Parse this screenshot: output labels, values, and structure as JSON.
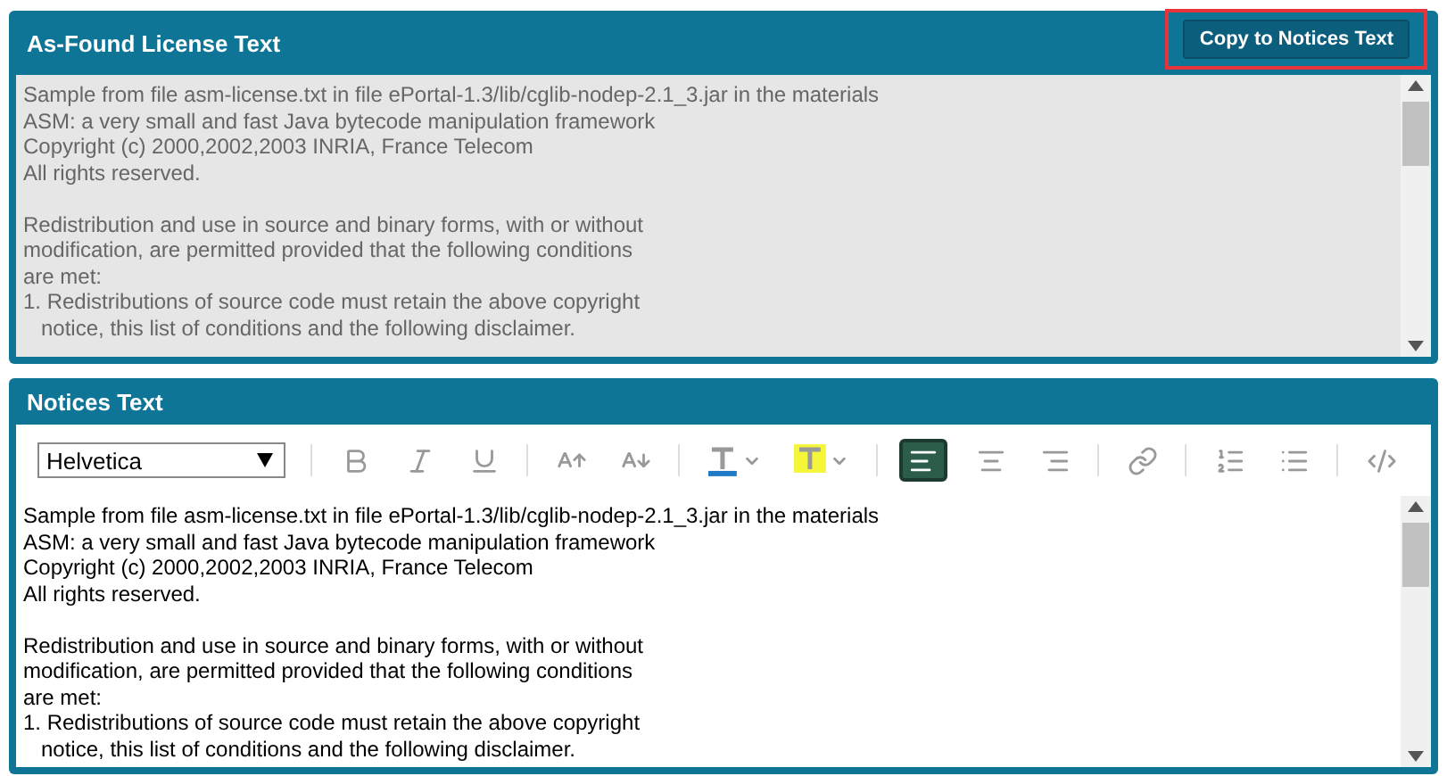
{
  "found_panel": {
    "title": "As-Found License Text",
    "copy_button": "Copy to Notices Text",
    "paragraphs": [
      [
        "Sample from file asm-license.txt in file ePortal-1.3/lib/cglib-nodep-2.1_3.jar in the materials",
        "ASM: a very small and fast Java bytecode manipulation framework",
        "Copyright (c) 2000,2002,2003 INRIA, France Telecom",
        "All rights reserved."
      ],
      [
        "Redistribution and use in source and binary forms, with or without",
        "modification, are permitted provided that the following conditions",
        "are met:",
        "1. Redistributions of source code must retain the above copyright",
        "   notice, this list of conditions and the following disclaimer."
      ]
    ]
  },
  "notices_panel": {
    "title": "Notices Text",
    "font_select": "Helvetica",
    "toolbar": [
      {
        "kind": "bold",
        "selected": false
      },
      {
        "kind": "italic",
        "selected": false
      },
      {
        "kind": "underline",
        "selected": false
      },
      {
        "kind": "separator"
      },
      {
        "kind": "size-up",
        "selected": false
      },
      {
        "kind": "size-down",
        "selected": false
      },
      {
        "kind": "separator"
      },
      {
        "kind": "text-color",
        "selected": false
      },
      {
        "kind": "highlight",
        "selected": false
      },
      {
        "kind": "separator"
      },
      {
        "kind": "align-left",
        "selected": true
      },
      {
        "kind": "align-center",
        "selected": false
      },
      {
        "kind": "align-right",
        "selected": false
      },
      {
        "kind": "separator"
      },
      {
        "kind": "link",
        "selected": false
      },
      {
        "kind": "separator"
      },
      {
        "kind": "ordered-list",
        "selected": false
      },
      {
        "kind": "bullet-list",
        "selected": false
      },
      {
        "kind": "separator"
      },
      {
        "kind": "source",
        "selected": false
      }
    ],
    "paragraphs": [
      [
        "Sample from file asm-license.txt in file ePortal-1.3/lib/cglib-nodep-2.1_3.jar in the materials",
        "ASM: a very small and fast Java bytecode manipulation framework",
        "Copyright (c) 2000,2002,2003 INRIA, France Telecom",
        "All rights reserved."
      ],
      [
        "Redistribution and use in source and binary forms, with or without",
        "modification, are permitted provided that the following conditions",
        "are met:",
        "1. Redistributions of source code must retain the above copyright",
        "   notice, this list of conditions and the following disclaimer."
      ]
    ]
  }
}
